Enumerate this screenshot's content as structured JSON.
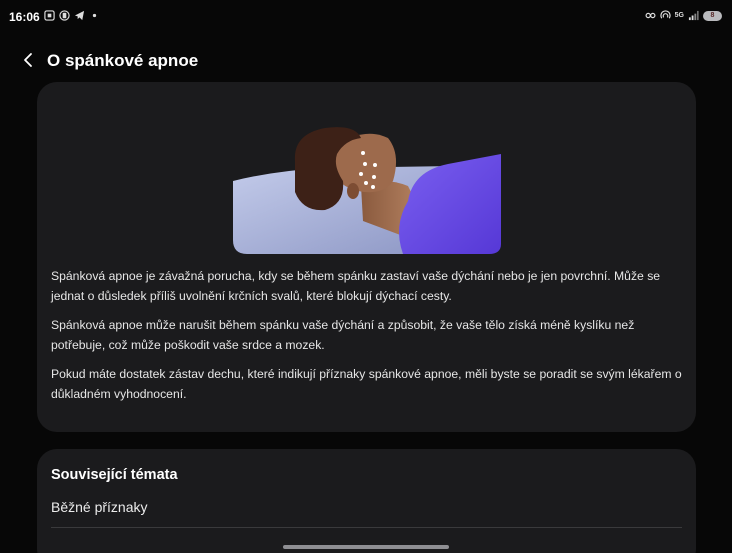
{
  "status_bar": {
    "time": "16:06",
    "network_label": "5G",
    "battery_level": "8"
  },
  "header": {
    "title": "O spánkové apnoe"
  },
  "main_card": {
    "paragraphs": [
      "Spánková apnoe je závažná porucha, kdy se během spánku zastaví vaše dýchání nebo je jen povrchní. Může se jednat o důsledek příliš uvolnění krčních svalů, které blokují dýchací cesty.",
      "Spánková apnoe může narušit během spánku vaše dýchání a způsobit, že vaše tělo získá méně kyslíku než potřebuje, což může poškodit vaše srdce a mozek.",
      "Pokud máte dostatek zástav dechu, které indikují příznaky spánkové apnoe, měli byste se poradit se svým lékařem o důkladném vyhodnocení."
    ]
  },
  "related": {
    "title": "Související témata",
    "items": [
      "Běžné příznaky"
    ]
  },
  "colors": {
    "background": "#070707",
    "card": "#1b1b1d",
    "blanket": "#6a4fe0",
    "pillow": "#aab4dc"
  }
}
